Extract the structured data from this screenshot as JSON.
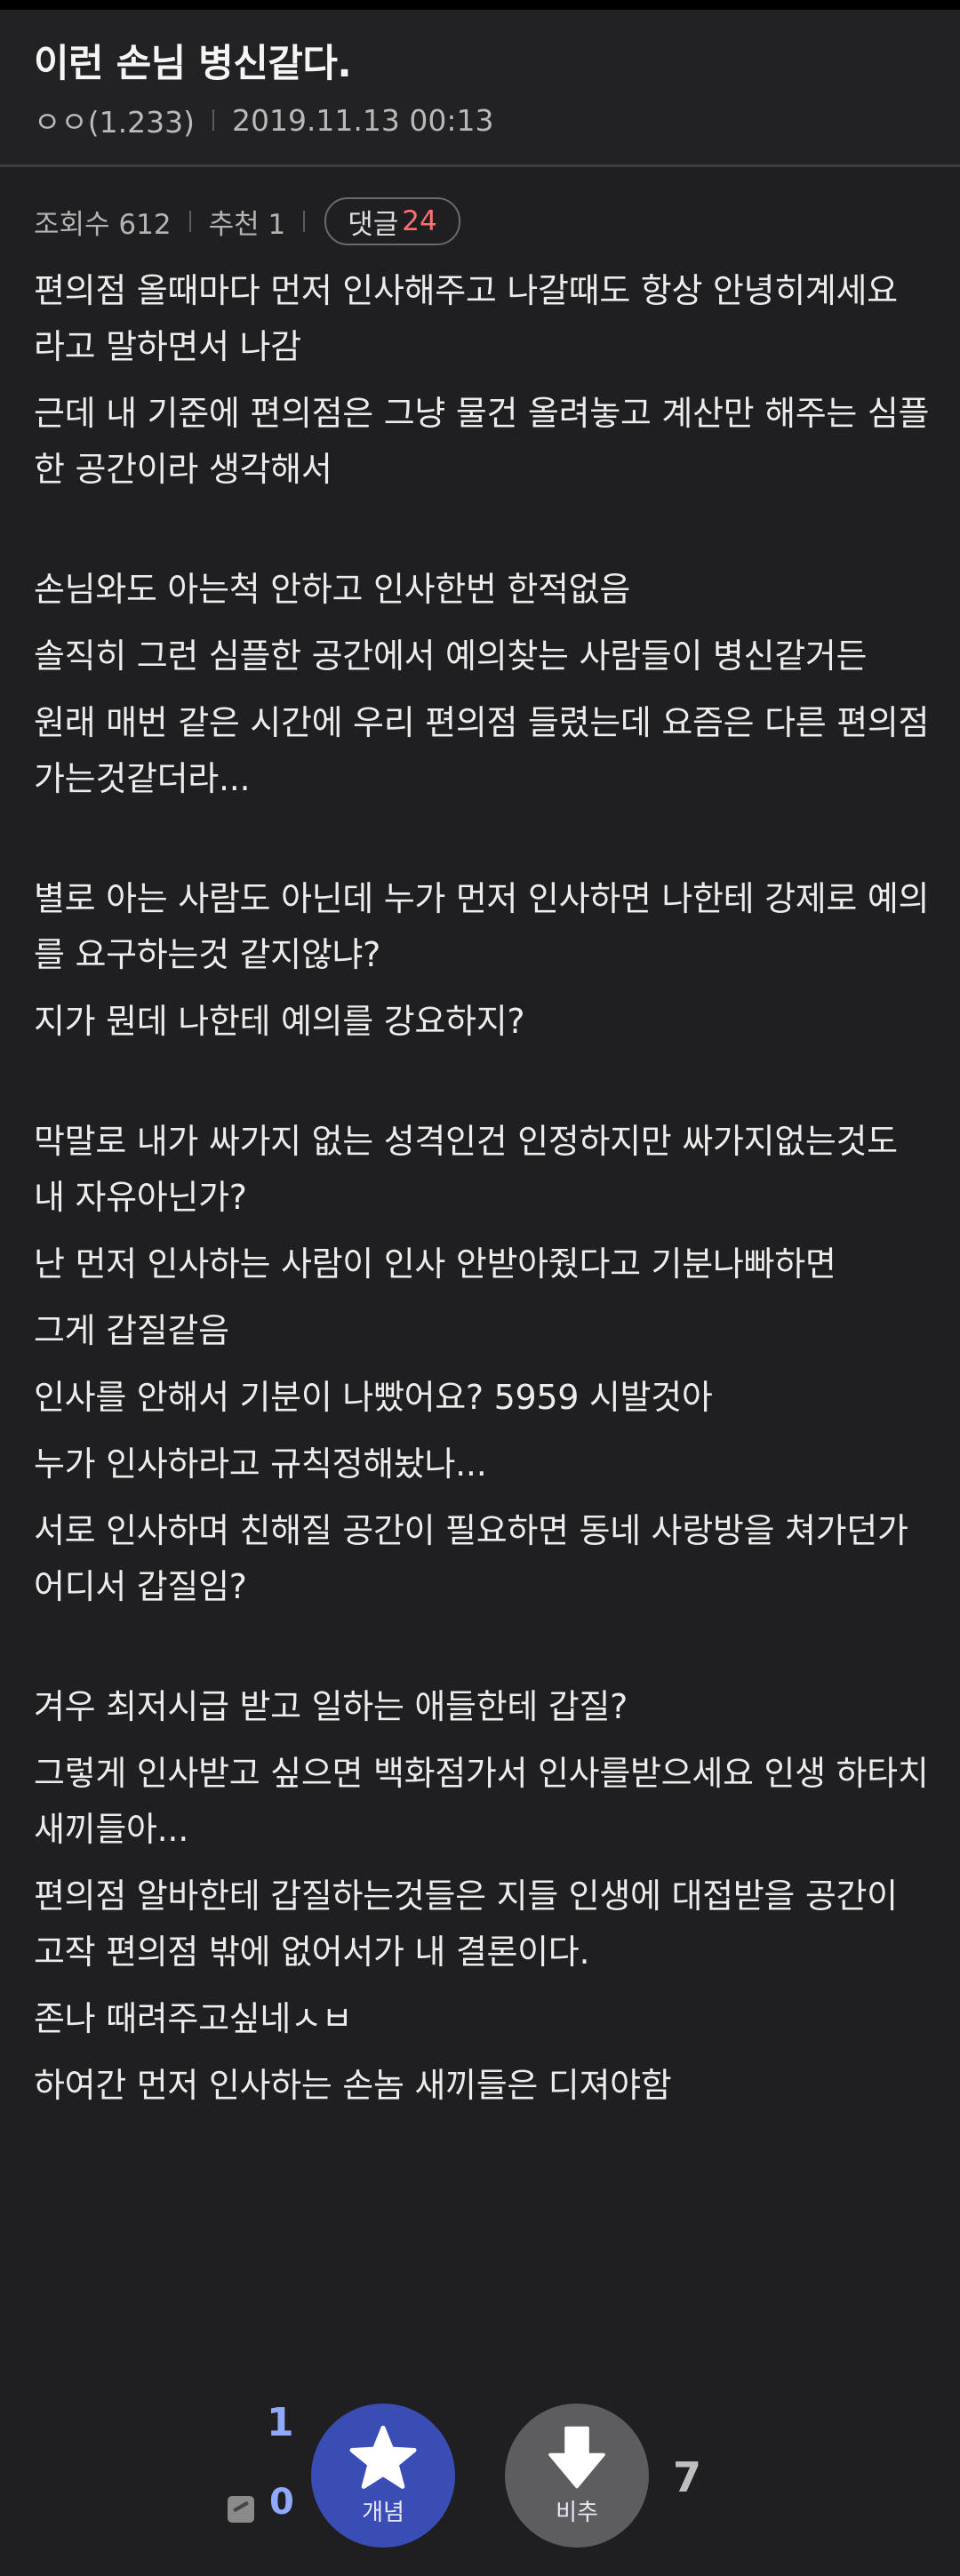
{
  "post": {
    "title": "이런 손님 병신같다.",
    "author": "ㅇㅇ(1.233)",
    "datetime": "2019.11.13 00:13",
    "views": "조회수 612",
    "recommend": "추천 1",
    "comments_label": "댓글",
    "comments_count": "24"
  },
  "body": [
    "편의점 올때마다 먼저 인사해주고 나갈때도 항상 안녕히계세요 라고 말하면서 나감",
    "근데 내 기준에 편의점은 그냥 물건 올려놓고 계산만 해주는 심플한 공간이라 생각해서",
    "",
    "손님와도 아는척 안하고 인사한번 한적없음",
    "솔직히 그런 심플한 공간에서 예의찾는 사람들이 병신같거든",
    "원래 매번 같은 시간에 우리 편의점 들렸는데 요즘은 다른 편의점 가는것같더라...",
    "",
    "별로 아는 사람도 아닌데 누가 먼저 인사하면 나한테 강제로 예의를 요구하는것 같지않냐?",
    "지가 뭔데 나한테 예의를 강요하지?",
    "",
    "막말로 내가 싸가지 없는 성격인건 인정하지만 싸가지없는것도 내 자유아닌가?",
    "난 먼저 인사하는 사람이 인사 안받아줬다고 기분나빠하면",
    "그게 갑질같음",
    "인사를 안해서 기분이 나빴어요? 5959 시발것아",
    "누가 인사하라고 규칙정해놨나...",
    "서로 인사하며 친해질 공간이 필요하면 동네 사랑방을 쳐가던가 어디서 갑질임?",
    "",
    "겨우 최저시급 받고 일하는 애들한테 갑질?",
    "그렇게 인사받고 싶으면 백화점가서 인사를받으세요 인생 하타치 새끼들아...",
    "편의점 알바한테 갑질하는것들은 지들 인생에 대접받을 공간이 고작 편의점 밖에 없어서가 내 결론이다.",
    "존나 때려주고싶네ㅅㅂ",
    "하여간 먼저 인사하는 손놈 새끼들은 디져야함"
  ],
  "votes": {
    "up_count": "1",
    "fix_count": "0",
    "up_label": "개념",
    "down_label": "비추",
    "down_count": "7",
    "up_color": "#3a4db5",
    "down_color": "#5d5d60",
    "up_icon": "star-icon",
    "down_icon": "arrow-down-icon"
  }
}
